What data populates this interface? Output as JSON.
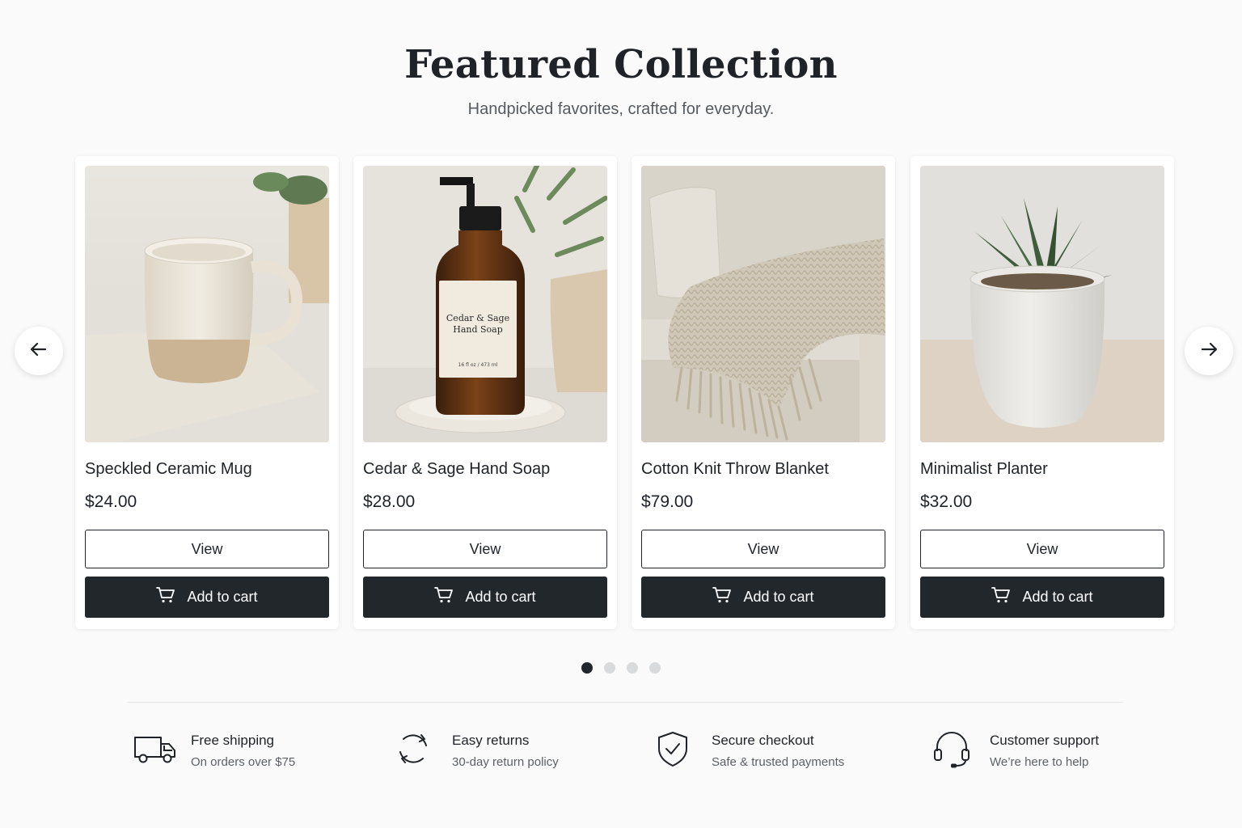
{
  "header": {
    "title": "Featured Collection",
    "subtitle": "Handpicked favorites, crafted for everyday."
  },
  "carousel": {
    "prev_icon": "arrow-left-icon",
    "next_icon": "arrow-right-icon",
    "pages": 4,
    "active_page": 1
  },
  "products": [
    {
      "name": "Speckled Ceramic Mug",
      "price": "$24.00",
      "view_label": "View",
      "cart_label": "Add to cart",
      "image": "ceramic-mug"
    },
    {
      "name": "Cedar & Sage Hand Soap",
      "price": "$28.00",
      "view_label": "View",
      "cart_label": "Add to cart",
      "image": "soap-bottle",
      "label_text": {
        "line1": "Cedar & Sage",
        "line2": "Hand Soap",
        "volume": "16 fl oz / 473 ml"
      }
    },
    {
      "name": "Cotton Knit Throw Blanket",
      "price": "$79.00",
      "view_label": "View",
      "cart_label": "Add to cart",
      "image": "throw-blanket"
    },
    {
      "name": "Minimalist Planter",
      "price": "$32.00",
      "view_label": "View",
      "cart_label": "Add to cart",
      "image": "planter"
    }
  ],
  "features": [
    {
      "title": "Free shipping",
      "subtitle": "On orders over $75",
      "icon": "truck-icon"
    },
    {
      "title": "Easy returns",
      "subtitle": "30-day return policy",
      "icon": "refresh-icon"
    },
    {
      "title": "Secure checkout",
      "subtitle": "Safe & trusted payments",
      "icon": "shield-check-icon"
    },
    {
      "title": "Customer support",
      "subtitle": "We’re here to help",
      "icon": "headset-icon"
    }
  ],
  "colors": {
    "background": "#fafafa",
    "dark_button": "#22272c",
    "text": "#1f2328",
    "muted_text": "#5d6166",
    "inactive_dot": "#d9dadc"
  }
}
